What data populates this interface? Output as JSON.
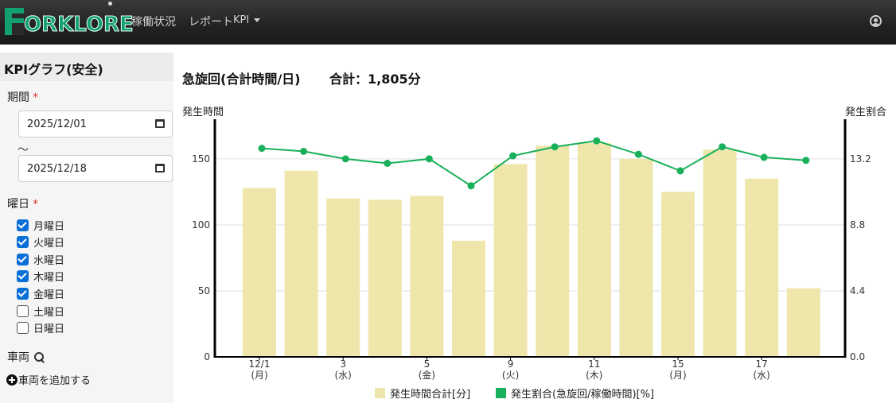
{
  "navbar": {
    "logo_text": "ORKLORE",
    "menu": [
      {
        "label": "稼働状況"
      },
      {
        "label": "レポート"
      },
      {
        "label": "KPI"
      }
    ]
  },
  "sidebar": {
    "title": "KPIグラフ(安全)",
    "period_label": "期間",
    "required_mark": "*",
    "date_from": "2025/12/01",
    "range_separator": "～",
    "date_to": "2025/12/18",
    "weekday_label": "曜日",
    "weekdays": [
      {
        "label": "月曜日",
        "checked": true
      },
      {
        "label": "火曜日",
        "checked": true
      },
      {
        "label": "水曜日",
        "checked": true
      },
      {
        "label": "木曜日",
        "checked": true
      },
      {
        "label": "金曜日",
        "checked": true
      },
      {
        "label": "土曜日",
        "checked": false
      },
      {
        "label": "日曜日",
        "checked": false
      }
    ],
    "vehicle_label": "車両",
    "add_vehicle_label": "車両を追加する"
  },
  "chart_header": {
    "title": "急旋回(合計時間/日)",
    "total": "合計：1,805分"
  },
  "chart_data": {
    "type": "bar",
    "title": "急旋回(合計時間/日)",
    "ylabel": "発生時間",
    "y2label": "発生割合",
    "ylim": [
      0,
      180
    ],
    "y2lim": [
      0,
      15.84
    ],
    "yticks": [
      0,
      50,
      100,
      150
    ],
    "y2ticks": [
      "0.0",
      "4.4",
      "8.8",
      "13.2"
    ],
    "grid": true,
    "legend_position": "bottom",
    "categories": [
      "12/1",
      "12/2",
      "12/3",
      "12/4",
      "12/5",
      "12/8",
      "12/9",
      "12/10",
      "12/11",
      "12/12",
      "12/15",
      "12/16",
      "12/17",
      "12/18"
    ],
    "x_tick_labels": [
      {
        "index": 0,
        "date": "12/1",
        "day": "(月)"
      },
      {
        "index": 2,
        "date": "3",
        "day": "(水)"
      },
      {
        "index": 4,
        "date": "5",
        "day": "(金)"
      },
      {
        "index": 6,
        "date": "9",
        "day": "(火)"
      },
      {
        "index": 8,
        "date": "11",
        "day": "(木)"
      },
      {
        "index": 10,
        "date": "15",
        "day": "(月)"
      },
      {
        "index": 12,
        "date": "17",
        "day": "(水)"
      }
    ],
    "series": [
      {
        "name": "発生時間合計[分]",
        "type": "bar",
        "axis": "left",
        "color": "#efe6ac",
        "values": [
          128,
          141,
          120,
          119,
          122,
          88,
          146,
          160,
          162,
          150,
          125,
          157,
          135,
          52
        ]
      },
      {
        "name": "発生割合(急旋回/稼働時間)[%]",
        "type": "line",
        "axis": "right",
        "color": "#18b05a",
        "values": [
          13.9,
          13.7,
          13.2,
          12.9,
          13.2,
          11.4,
          13.4,
          14.0,
          14.4,
          13.5,
          12.4,
          14.0,
          13.3,
          13.1
        ]
      }
    ]
  }
}
